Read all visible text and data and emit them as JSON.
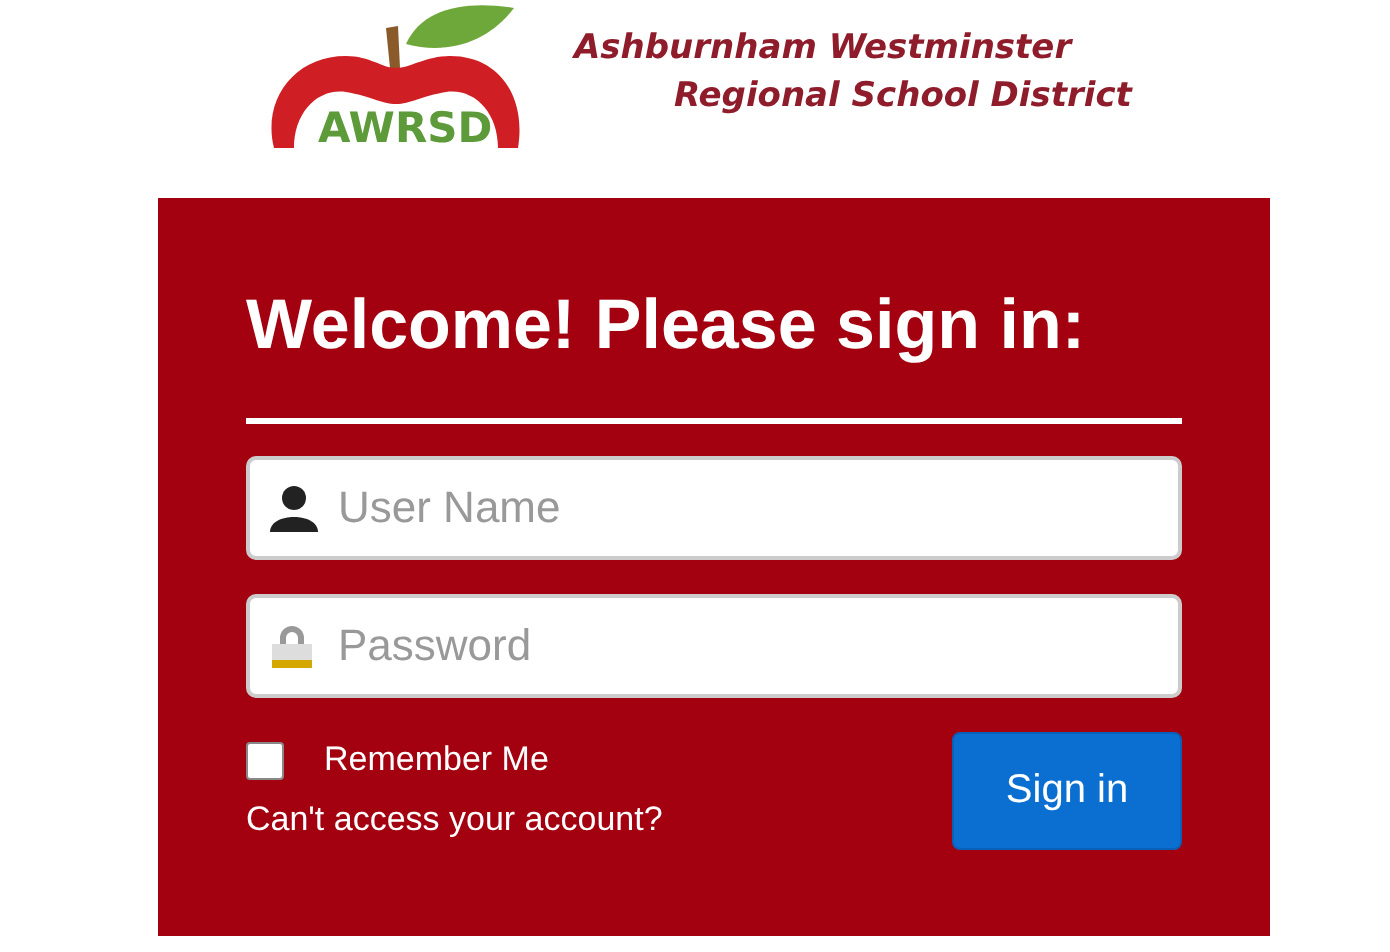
{
  "header": {
    "logo_text": "AWRSD",
    "district_lines": [
      "Ashburnham Westminster",
      "Regional School District"
    ]
  },
  "login": {
    "title": "Welcome! Please sign in:",
    "fields": [
      {
        "kind": "user",
        "placeholder": "User Name"
      },
      {
        "kind": "password",
        "placeholder": "Password"
      }
    ],
    "remember": {
      "label": "Remember Me",
      "checked": false
    },
    "help_link": "Can't access your account?",
    "submit": "Sign in"
  }
}
